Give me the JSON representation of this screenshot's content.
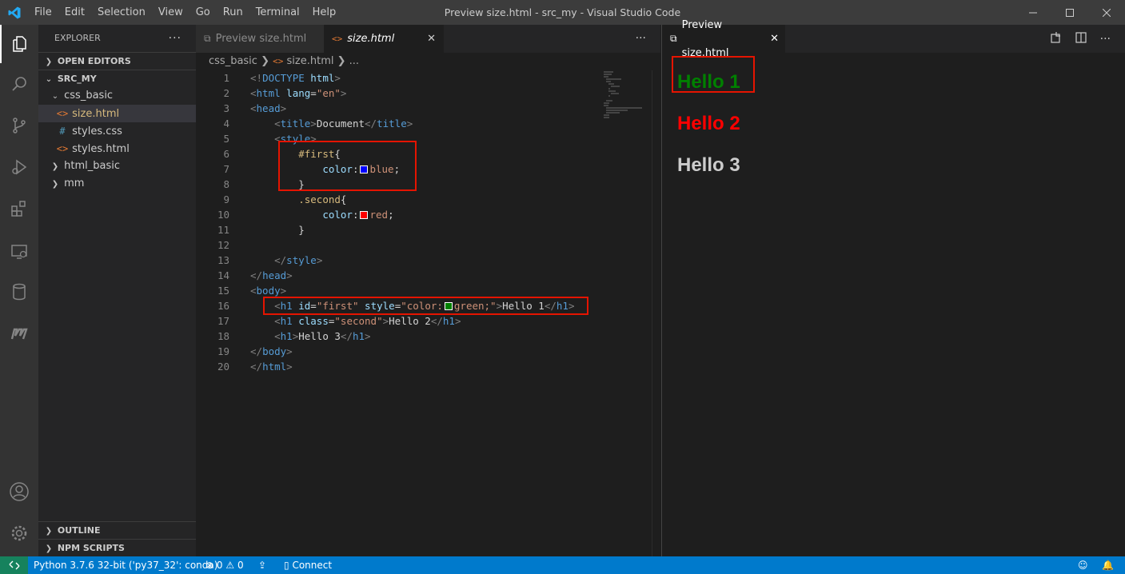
{
  "window": {
    "title": "Preview size.html - src_my - Visual Studio Code"
  },
  "menu": [
    "File",
    "Edit",
    "Selection",
    "View",
    "Go",
    "Run",
    "Terminal",
    "Help"
  ],
  "activity_icons": [
    "explorer-icon",
    "search-icon",
    "source-control-icon",
    "run-debug-icon",
    "extensions-icon",
    "remote-explorer-icon",
    "database-icon",
    "mongo-icon",
    "account-icon",
    "settings-gear-icon"
  ],
  "sidebar": {
    "title": "EXPLORER",
    "open_editors": "OPEN EDITORS",
    "root": "SRC_MY",
    "tree": [
      {
        "label": "css_basic",
        "kind": "folder-open"
      },
      {
        "label": "size.html",
        "kind": "html"
      },
      {
        "label": "styles.css",
        "kind": "css"
      },
      {
        "label": "styles.html",
        "kind": "html"
      },
      {
        "label": "html_basic",
        "kind": "folder"
      },
      {
        "label": "mm",
        "kind": "folder"
      }
    ],
    "outline": "OUTLINE",
    "npm": "NPM SCRIPTS"
  },
  "editor": {
    "tabs": [
      {
        "label": "Preview size.html"
      },
      {
        "label": "size.html"
      }
    ],
    "breadcrumb": {
      "folder": "css_basic",
      "file": "size.html",
      "more": "..."
    },
    "line_numbers": [
      "1",
      "2",
      "3",
      "4",
      "5",
      "6",
      "7",
      "8",
      "9",
      "10",
      "11",
      "12",
      "13",
      "14",
      "15",
      "16",
      "17",
      "18",
      "19",
      "20"
    ],
    "swatches": {
      "blue": "#0000ff",
      "red": "#ff0000",
      "green": "#008000"
    }
  },
  "preview": {
    "tab_label": "Preview size.html",
    "headings": [
      {
        "text": "Hello 1",
        "color": "#008000"
      },
      {
        "text": "Hello 2",
        "color": "#ff0000"
      },
      {
        "text": "Hello 3",
        "color": "#cccccc"
      }
    ]
  },
  "status": {
    "python": "Python 3.7.6 32-bit ('py37_32': conda)",
    "errors": "0",
    "warnings": "0",
    "connect": "Connect"
  },
  "colors": {
    "accent": "#007acc",
    "highlight_box": "#e51400",
    "remote": "#16825d"
  }
}
